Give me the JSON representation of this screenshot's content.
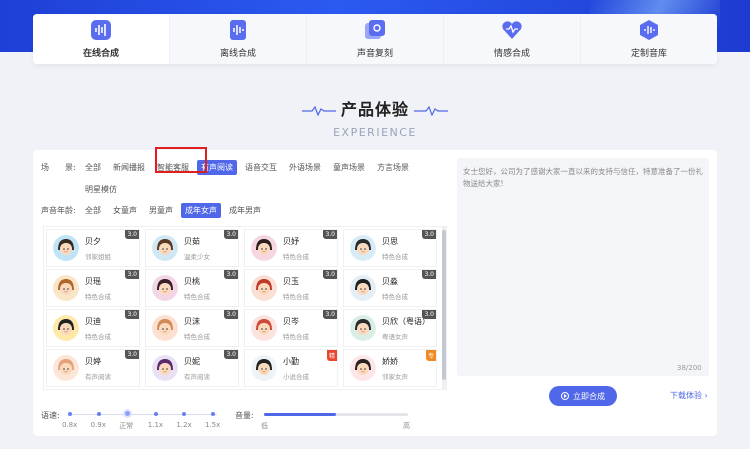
{
  "tabs": [
    {
      "label": "在线合成",
      "icon": "audio-wave-icon",
      "active": true
    },
    {
      "label": "离线合成",
      "icon": "audio-file-icon",
      "active": false
    },
    {
      "label": "声音复刻",
      "icon": "voice-clone-icon",
      "active": false
    },
    {
      "label": "情感合成",
      "icon": "heart-wave-icon",
      "active": false
    },
    {
      "label": "定制音库",
      "icon": "voice-library-icon",
      "active": false
    }
  ],
  "heading": {
    "title": "产品体验",
    "subtitle": "EXPERIENCE"
  },
  "filters": {
    "scene": {
      "label": "场　　景:",
      "options": [
        "全部",
        "新闻播报",
        "智能客服",
        "有声阅读",
        "语音交互",
        "外语场景",
        "童声场景",
        "方言场景"
      ],
      "row2": [
        "明星模仿"
      ],
      "selected": "有声阅读"
    },
    "age": {
      "label": "声音年龄:",
      "options": [
        "全部",
        "女童声",
        "男童声",
        "成年女声",
        "成年男声"
      ],
      "selected": "成年女声"
    }
  },
  "voices": [
    {
      "name": "贝夕",
      "tag": "邻家姐姐",
      "badge": "3.0"
    },
    {
      "name": "贝茹",
      "tag": "温柔少女",
      "badge": "3.0"
    },
    {
      "name": "贝妤",
      "tag": "特色合成",
      "badge": "3.0"
    },
    {
      "name": "贝思",
      "tag": "特色合成",
      "badge": "3.0"
    },
    {
      "name": "贝瑶",
      "tag": "特色合成",
      "badge": "3.0"
    },
    {
      "name": "贝桃",
      "tag": "特色合成",
      "badge": "3.0"
    },
    {
      "name": "贝玉",
      "tag": "特色合成",
      "badge": "3.0"
    },
    {
      "name": "贝淼",
      "tag": "特色合成",
      "badge": "3.0"
    },
    {
      "name": "贝迪",
      "tag": "特色合成",
      "badge": "3.0"
    },
    {
      "name": "贝沫",
      "tag": "特色合成",
      "badge": "3.0"
    },
    {
      "name": "贝岑",
      "tag": "特色合成",
      "badge": "3.0"
    },
    {
      "name": "贝欣（粤语）",
      "tag": "粤语女声",
      "badge": "3.0"
    },
    {
      "name": "贝婷",
      "tag": "有声阅读",
      "badge": "3.0"
    },
    {
      "name": "贝妮",
      "tag": "有声阅读",
      "badge": "3.0"
    },
    {
      "name": "小勤",
      "tag": "小说合成",
      "badge": "精"
    },
    {
      "name": "娇娇",
      "tag": "邻家女声",
      "badge": "专"
    }
  ],
  "text_input": {
    "value": "女士您好，公司为了感谢大家一直以来的支持与信任，特意准备了一份礼物送给大家!",
    "counter": "38/200"
  },
  "actions": {
    "synthesize": "立即合成",
    "download": "下载体验"
  },
  "speed": {
    "label": "语速:",
    "options": [
      "0.8x",
      "0.9x",
      "正常",
      "1.1x",
      "1.2x",
      "1.5x"
    ],
    "selected": "正常"
  },
  "volume": {
    "label": "音量:",
    "low": "低",
    "high": "高",
    "level": 0.5
  },
  "colors": {
    "accent": "#4f67e8",
    "highlight": "#e02020"
  }
}
